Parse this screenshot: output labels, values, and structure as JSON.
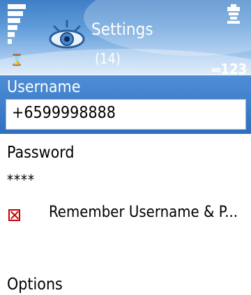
{
  "header": {
    "title": "Settings",
    "subtitle": "(14)",
    "input_mode": "࿎123",
    "icons": [
      "signal-strength-icon",
      "hourglass-icon",
      "eye-settings-icon",
      "battery-icon"
    ]
  },
  "form": {
    "username_label": "Username",
    "username_value": "+6599998888",
    "password_label": "Password",
    "password_value": "****",
    "remember_label": "Remember Username & P...",
    "remember_checked": false,
    "options_label": "Options"
  },
  "colors": {
    "header_blue": "#3f7fc6",
    "selected_row": "#3a7ac9",
    "checkbox_red": "#c40000"
  }
}
